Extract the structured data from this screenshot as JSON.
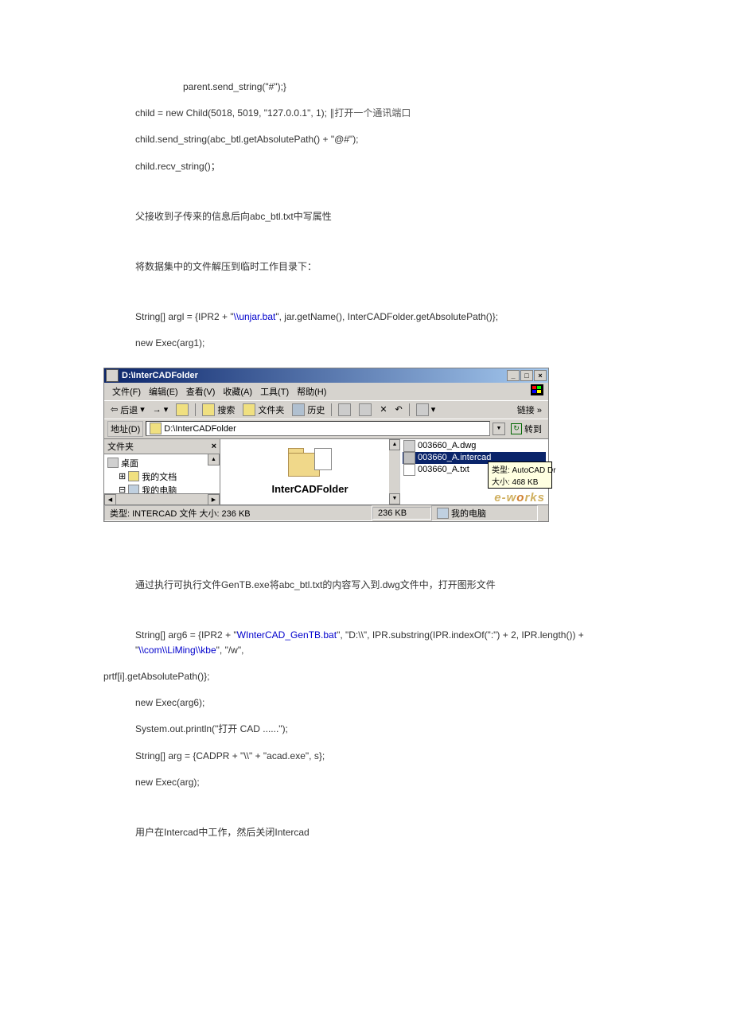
{
  "code": {
    "l1": "parent.send_string(\"#\");}",
    "l2a": "child = new Child(5018, 5019, \"127.0.0.1\", 1);  ",
    "l2b": "∥打开一个通讯端口",
    "l3": "child.send_string(abc_btl.getAbsolutePath() + \"@#\");",
    "l4": "child.recv_string()；",
    "l5": "父接收到子传来的信息后向abc_btl.txt中写属性",
    "l6": "将数据集中的文件解压到临时工作目录下：",
    "l7a": "String[] argl = {IPR2 + \"",
    "l7b": "\\\\unjar.bat",
    "l7c": "\", jar.getName(), InterCADFolder.getAbsolutePath()};",
    "l8": "new Exec(arg1);",
    "l9": "通过执行可执行文件GenTB.exe将abc_btl.txt的内容写入到.dwg文件中，打开图形文件",
    "l10a": "String[] arg6 = {IPR2 + \"",
    "l10b": "WInterCAD_GenTB.bat",
    "l10c": "\", \"D:\\\\\", IPR.substring(IPR.indexOf(\":\") + 2, IPR.length()) + \"",
    "l10d": "\\\\com\\\\LiMing\\\\kbe",
    "l10e": "\", \"/w\",",
    "l11": "prtf[i].getAbsolutePath()};",
    "l12": "new Exec(arg6);",
    "l13": "System.out.println(\"打开  CAD ......\");",
    "l14": "String[] arg = {CADPR + \"\\\\\" + \"acad.exe\", s};",
    "l15": "new Exec(arg);",
    "l16": "用户在Intercad中工作，然后关闭Intercad"
  },
  "scr": {
    "title": "D:\\InterCADFolder",
    "menus": {
      "file": "文件(F)",
      "edit": "编辑(E)",
      "view": "查看(V)",
      "fav": "收藏(A)",
      "tools": "工具(T)",
      "help": "帮助(H)"
    },
    "toolbar": {
      "back": "后退",
      "search": "搜索",
      "folders": "文件夹",
      "history": "历史",
      "links": "链接 »"
    },
    "addr": {
      "label": "地址(D)",
      "path": "D:\\InterCADFolder",
      "go": "转到"
    },
    "left": {
      "title": "文件夹",
      "desktop": "桌面",
      "mydocs": "我的文档",
      "mypc": "我的电脑"
    },
    "mid": {
      "name": "InterCADFolder"
    },
    "files": {
      "f1": "003660_A.dwg",
      "f2": "003660_A.intercad",
      "f3": "003660_A.txt"
    },
    "tooltip": {
      "l1": "类型: AutoCAD Dr",
      "l2": "大小: 468 KB"
    },
    "status": {
      "left": "类型: INTERCAD 文件 大小: 236 KB",
      "mid": "236 KB",
      "right": "我的电脑"
    },
    "watermark": {
      "pre": "e-w",
      "o": "o",
      "post": "rks"
    }
  }
}
